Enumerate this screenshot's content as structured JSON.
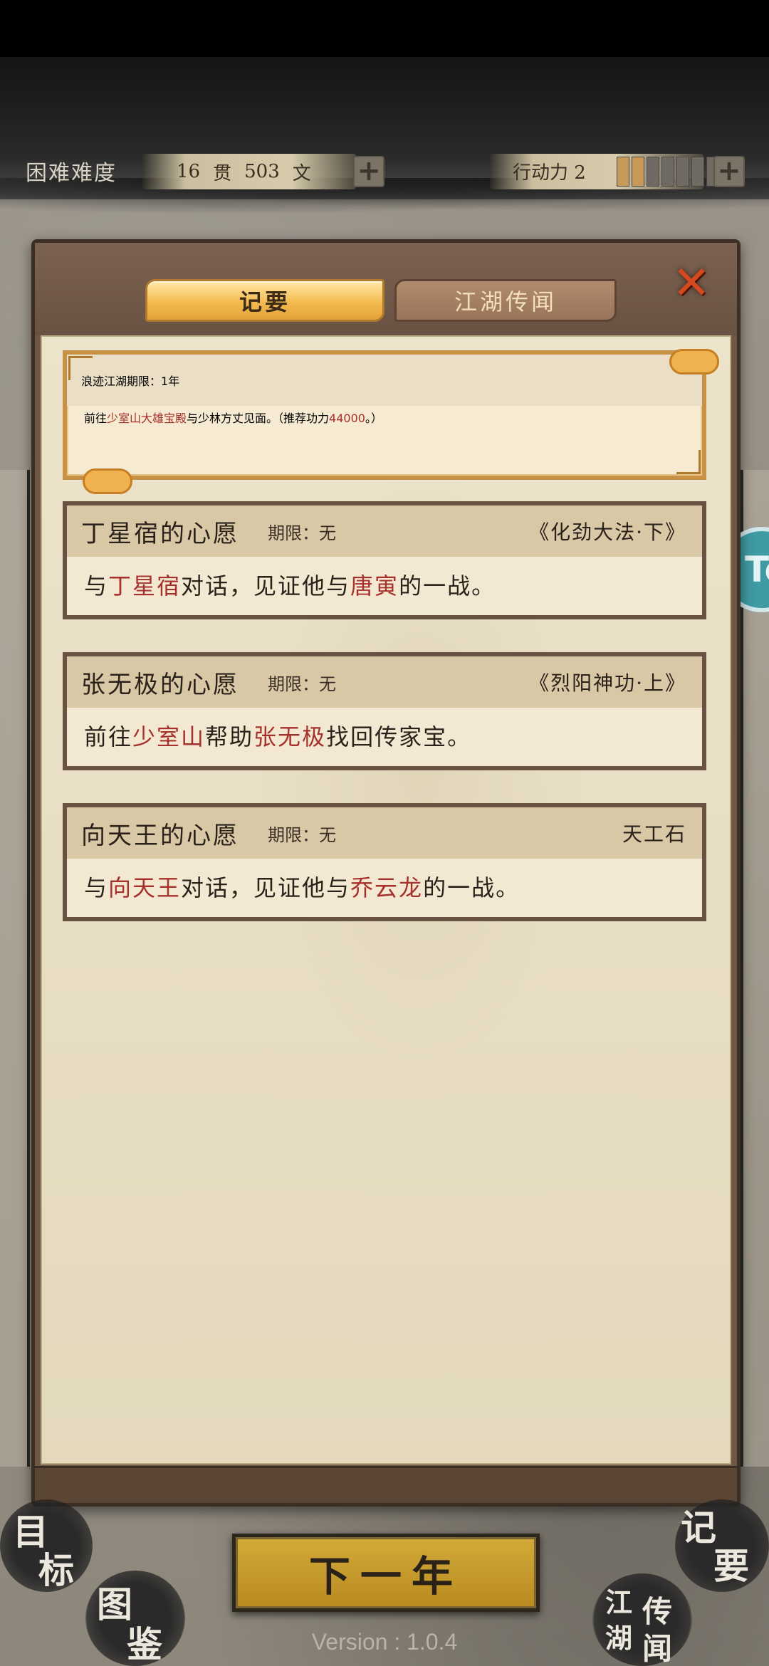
{
  "hud": {
    "difficulty": "困难难度",
    "money_guan": "16",
    "money_guan_unit": "贯",
    "money_wen": "503",
    "money_wen_unit": "文",
    "action_label": "行动力 2",
    "action_segments_filled": 2,
    "action_segments_total": 7
  },
  "tabs": {
    "active": "记要",
    "inactive": "江湖传闻"
  },
  "quests": [
    {
      "title": "浪迹江湖",
      "period": "期限：1年",
      "reward": "",
      "desc_parts": [
        "前往",
        "少室山大雄宝殿",
        "与少林方丈见面。（推荐功力",
        "44000",
        "。）"
      ]
    },
    {
      "title": "丁星宿的心愿",
      "period": "期限：无",
      "reward": "《化劲大法·下》",
      "desc_parts": [
        "与",
        "丁星宿",
        "对话，见证他与",
        "唐寅",
        "的一战。"
      ]
    },
    {
      "title": "张无极的心愿",
      "period": "期限：无",
      "reward": "《烈阳神功·上》",
      "desc_parts": [
        "前往",
        "少室山",
        "帮助",
        "张无极",
        "找回传家宝。"
      ]
    },
    {
      "title": "向天王的心愿",
      "period": "期限：无",
      "reward": "天工石",
      "desc_parts": [
        "与",
        "向天王",
        "对话，见证他与",
        "乔云龙",
        "的一战。"
      ]
    }
  ],
  "bottom": {
    "next_year": "下一年",
    "goal_a": "目",
    "goal_b": "标",
    "atlas_a": "图",
    "atlas_b": "鉴",
    "notes_a": "记",
    "notes_b": "要",
    "rumor_a": "江",
    "rumor_b": "湖",
    "rumor_c": "传",
    "rumor_d": "闻",
    "version": "Version : 1.0.4"
  },
  "side_bubble_text": "To",
  "colors": {
    "highlight_red": "#a6302b",
    "tab_active": "#f4bb4f",
    "button_gold": "#d3aa3a"
  }
}
